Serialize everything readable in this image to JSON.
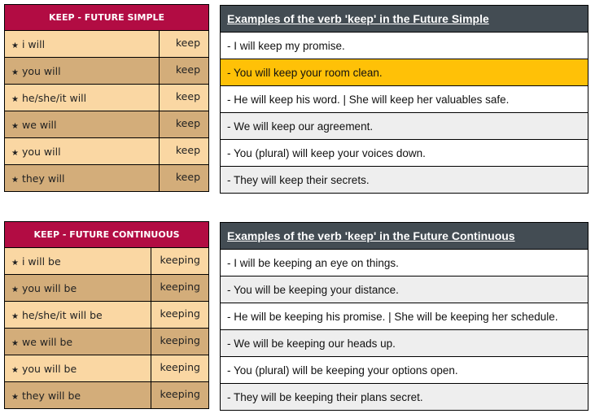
{
  "colors": {
    "conj_header": "#b20c43",
    "row_light": "#fad7a3",
    "row_dark": "#d3ad7a",
    "examples_header": "#434c53",
    "highlight": "#ffc107",
    "grey_row": "#eeeeee"
  },
  "icons": {
    "bullet": "★"
  },
  "future_simple": {
    "title": "KEEP - FUTURE SIMPLE",
    "rows": [
      {
        "pronoun": "i will",
        "verb": "keep"
      },
      {
        "pronoun": "you will",
        "verb": "keep"
      },
      {
        "pronoun": "he/she/it will",
        "verb": "keep"
      },
      {
        "pronoun": "we will",
        "verb": "keep"
      },
      {
        "pronoun": "you will",
        "verb": "keep"
      },
      {
        "pronoun": "they will",
        "verb": "keep"
      }
    ],
    "examples_title": "Examples of the verb 'keep' in the Future Simple",
    "examples": [
      "- I will keep my promise.",
      "- You will keep your room clean.",
      "- He will keep his word. | She will keep her valuables safe.",
      "- We will keep our agreement.",
      "- You (plural) will keep your voices down.",
      "- They will keep their secrets."
    ]
  },
  "future_continuous": {
    "title": "KEEP - FUTURE CONTINUOUS",
    "rows": [
      {
        "pronoun": "i will be",
        "verb": "keeping"
      },
      {
        "pronoun": "you will be",
        "verb": "keeping"
      },
      {
        "pronoun": "he/she/it will be",
        "verb": "keeping"
      },
      {
        "pronoun": "we will be",
        "verb": "keeping"
      },
      {
        "pronoun": "you will be",
        "verb": "keeping"
      },
      {
        "pronoun": "they will be",
        "verb": "keeping"
      }
    ],
    "examples_title": "Examples of the verb 'keep' in the Future Continuous",
    "examples": [
      "- I will be keeping an eye on things.",
      "- You will be keeping your distance.",
      "- He will be keeping his promise. | She will be keeping her schedule.",
      "- We will be keeping our heads up.",
      "- You (plural) will be keeping your options open.",
      "- They will be keeping their plans secret."
    ]
  }
}
